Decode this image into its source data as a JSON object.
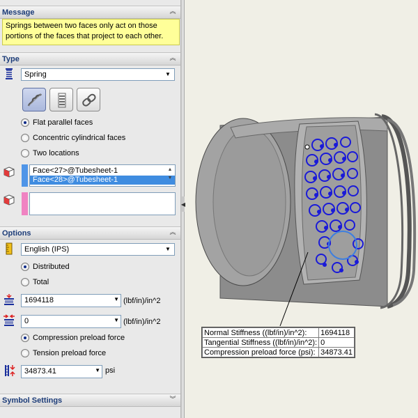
{
  "message": {
    "title": "Message",
    "text": "Springs between two faces only act on those portions of the faces that project to each other."
  },
  "type": {
    "title": "Type",
    "connector_type": "Spring",
    "toggles": [
      "spring-icon",
      "bearing-icon",
      "link-icon"
    ],
    "face_options": [
      "Flat parallel faces",
      "Concentric cylindrical faces",
      "Two locations"
    ],
    "selected_face_option": "Flat parallel faces",
    "selected_faces": [
      "Face<27>@Tubesheet-1",
      "Face<28>@Tubesheet-1"
    ],
    "colors": {
      "selection_1": "#4f95e8",
      "selection_2": "#f083c2"
    }
  },
  "options": {
    "title": "Options",
    "units": "English (IPS)",
    "distribution": [
      "Distributed",
      "Total"
    ],
    "selected_distribution": "Distributed",
    "normal_stiffness": "1694118",
    "normal_stiffness_unit": "(lbf/in)/in^2",
    "tangential_stiffness": "0",
    "tangential_stiffness_unit": "(lbf/in)/in^2",
    "preload_options": [
      "Compression  preload force",
      "Tension preload force"
    ],
    "selected_preload": "Compression  preload force",
    "preload_value": "34873.41",
    "preload_unit": "psi"
  },
  "symbol_settings": {
    "title": "Symbol Settings"
  },
  "callout": {
    "rows": [
      {
        "label": "Normal Stiffness ((lbf/in)/in^2):",
        "value": "1694118"
      },
      {
        "label": "Tangential Stiffness ((lbf/in)/in^2):",
        "value": "0"
      },
      {
        "label": "Compression  preload force (psi):",
        "value": "34873.41"
      }
    ]
  }
}
